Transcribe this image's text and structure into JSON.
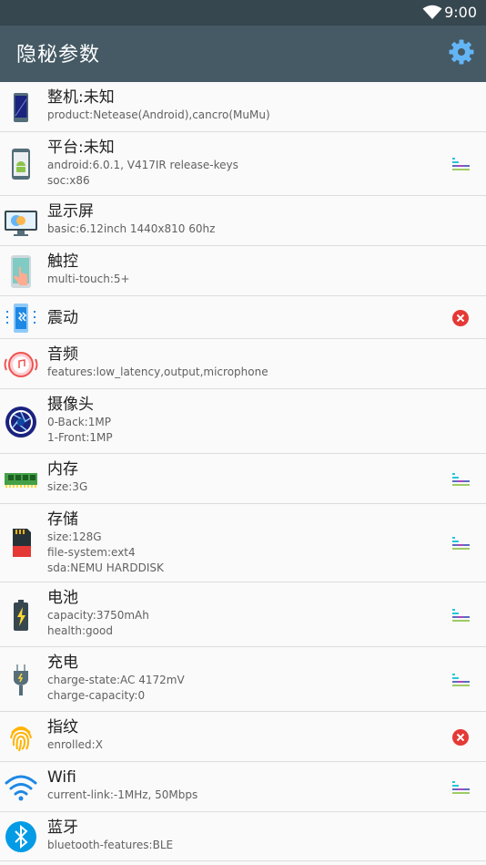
{
  "status_bar": {
    "time": "9:00",
    "wifi_icon": "wifi-icon"
  },
  "app_bar": {
    "title": "隐秘参数",
    "settings_icon": "gear-icon"
  },
  "colors": {
    "app_bar": "#455a64",
    "status_bar": "#37474f",
    "error": "#e53935"
  },
  "items": [
    {
      "name": "整机:未知",
      "lines": [
        "product:Netease(Android),cancro(MuMu)"
      ],
      "icon": "phone-icon",
      "badge": null
    },
    {
      "name": "平台:未知",
      "lines": [
        "android:6.0.1, V417IR release-keys",
        "soc:x86"
      ],
      "icon": "android-icon",
      "badge": "bars"
    },
    {
      "name": "显示屏",
      "lines": [
        "basic:6.12inch 1440x810 60hz"
      ],
      "icon": "monitor-icon",
      "badge": null
    },
    {
      "name": "触控",
      "lines": [
        "multi-touch:5+"
      ],
      "icon": "touch-icon",
      "badge": null
    },
    {
      "name": "震动",
      "lines": [],
      "icon": "vibration-icon",
      "badge": "error"
    },
    {
      "name": "音频",
      "lines": [
        "features:low_latency,output,microphone"
      ],
      "icon": "audio-icon",
      "badge": null
    },
    {
      "name": "摄像头",
      "lines": [
        "0-Back:1MP",
        "1-Front:1MP"
      ],
      "icon": "camera-icon",
      "badge": null
    },
    {
      "name": "内存",
      "lines": [
        "size:3G"
      ],
      "icon": "ram-icon",
      "badge": "bars"
    },
    {
      "name": "存储",
      "lines": [
        "size:128G",
        "file-system:ext4",
        "sda:NEMU HARDDISK"
      ],
      "icon": "sdcard-icon",
      "badge": "bars"
    },
    {
      "name": "电池",
      "lines": [
        "capacity:3750mAh",
        "health:good"
      ],
      "icon": "battery-icon",
      "badge": "bars"
    },
    {
      "name": "充电",
      "lines": [
        "charge-state:AC 4172mV",
        "charge-capacity:0"
      ],
      "icon": "plug-icon",
      "badge": "bars"
    },
    {
      "name": "指纹",
      "lines": [
        "enrolled:X"
      ],
      "icon": "fingerprint-icon",
      "badge": "error"
    },
    {
      "name": "Wifi",
      "lines": [
        "current-link:-1MHz, 50Mbps"
      ],
      "icon": "wifi-icon",
      "badge": "bars"
    },
    {
      "name": "蓝牙",
      "lines": [
        "bluetooth-features:BLE"
      ],
      "icon": "bluetooth-icon",
      "badge": null
    }
  ]
}
